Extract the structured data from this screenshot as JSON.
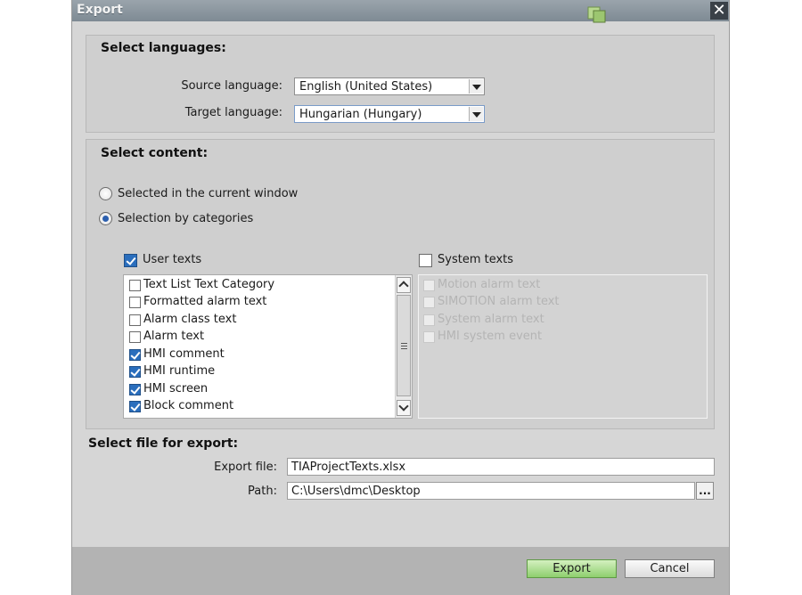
{
  "window": {
    "title": "Export",
    "close_glyph": "✕",
    "logo_icon": "tia-portal-logo"
  },
  "languages": {
    "heading": "Select languages:",
    "source_label": "Source language:",
    "source_value": "English (United States)",
    "target_label": "Target language:",
    "target_value": "Hungarian (Hungary)"
  },
  "content": {
    "heading": "Select content:",
    "radio_current": "Selected in the current window",
    "radio_categories": "Selection by categories",
    "selected_radio": "categories",
    "user_texts": {
      "label": "User texts",
      "checked": true,
      "items": [
        {
          "label": "Text List Text Category",
          "checked": false
        },
        {
          "label": "Formatted alarm text",
          "checked": false
        },
        {
          "label": "Alarm class text",
          "checked": false
        },
        {
          "label": "Alarm text",
          "checked": false
        },
        {
          "label": "HMI comment",
          "checked": true
        },
        {
          "label": "HMI runtime",
          "checked": true
        },
        {
          "label": "HMI screen",
          "checked": true
        },
        {
          "label": "Block comment",
          "checked": true
        }
      ]
    },
    "system_texts": {
      "label": "System texts",
      "checked": false,
      "items": [
        {
          "label": "Motion alarm text",
          "checked": false
        },
        {
          "label": "SIMOTION alarm text",
          "checked": false
        },
        {
          "label": "System alarm text",
          "checked": false
        },
        {
          "label": "HMI system event",
          "checked": false
        }
      ]
    }
  },
  "file": {
    "heading": "Select file for export:",
    "export_file_label": "Export file:",
    "export_file_value": "TIAProjectTexts.xlsx",
    "path_label": "Path:",
    "path_value": "C:\\Users\\dmc\\Desktop",
    "browse_label": "..."
  },
  "buttons": {
    "export": "Export",
    "cancel": "Cancel"
  },
  "colors": {
    "titlebar": "#8a949c",
    "dialog_bg": "#d6d6d6",
    "footer_bg": "#b3b3b3",
    "check_blue": "#2a6ebd",
    "primary_green": "#8ecf6e"
  }
}
